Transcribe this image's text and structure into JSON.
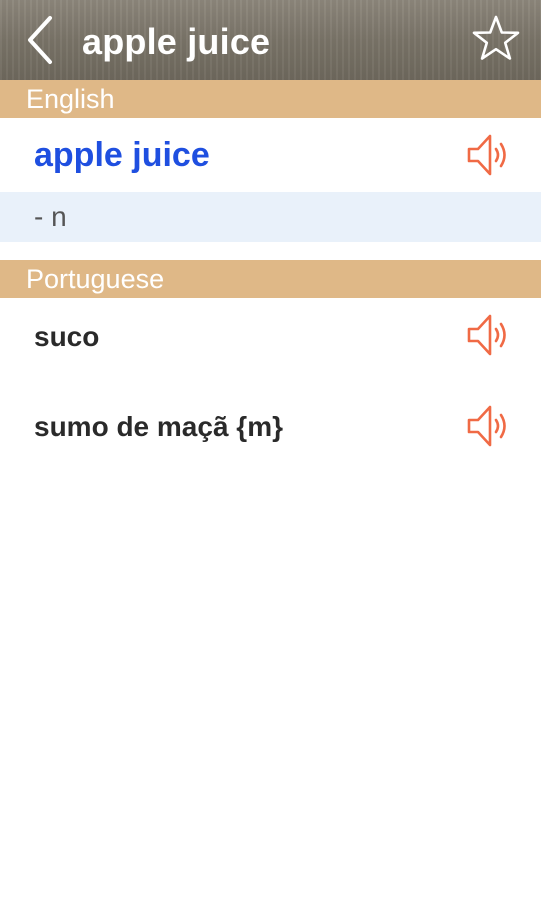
{
  "header": {
    "title": "apple juice"
  },
  "sections": {
    "english": {
      "label": "English",
      "headword": "apple juice",
      "part_of_speech": "- n"
    },
    "portuguese": {
      "label": "Portuguese",
      "translations": [
        {
          "text": "suco"
        },
        {
          "text": "sumo de maçã {m}"
        }
      ]
    }
  },
  "icons": {
    "back": "chevron-left-icon",
    "favorite": "star-outline-icon",
    "audio": "speaker-icon"
  },
  "colors": {
    "section_header_bg": "#dfb887",
    "headword_text": "#1f4fe0",
    "speaker_icon": "#f06a45",
    "pos_row_bg": "#e9f1fa"
  }
}
